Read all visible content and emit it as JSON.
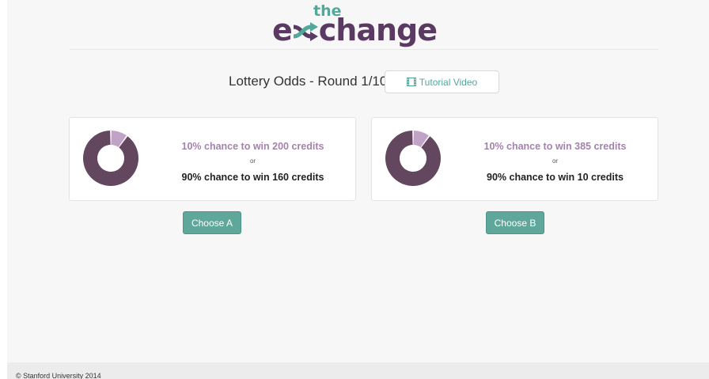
{
  "logo": {
    "prefix": "e",
    "the": "the",
    "suffix": "change"
  },
  "header": {
    "round_title": "Lottery Odds - Round 1/10",
    "tutorial_label": "Tutorial Video",
    "tutorial_icon": "film-icon"
  },
  "options": [
    {
      "win_chance_pct": 10,
      "line1": "10% chance to win 200 credits",
      "or": "or",
      "line2": "90% chance to win 160 credits",
      "button": "Choose A"
    },
    {
      "win_chance_pct": 10,
      "line1": "10% chance to win 385 credits",
      "or": "or",
      "line2": "90% chance to win 10 credits",
      "button": "Choose B"
    }
  ],
  "colors": {
    "primary": "#5a3a63",
    "accent": "#52a89a",
    "slice_light": "#c2a3c8",
    "slice_dark": "#63475f",
    "button": "#5fa79a"
  },
  "footer": {
    "copyright": "© Stanford University 2014"
  }
}
